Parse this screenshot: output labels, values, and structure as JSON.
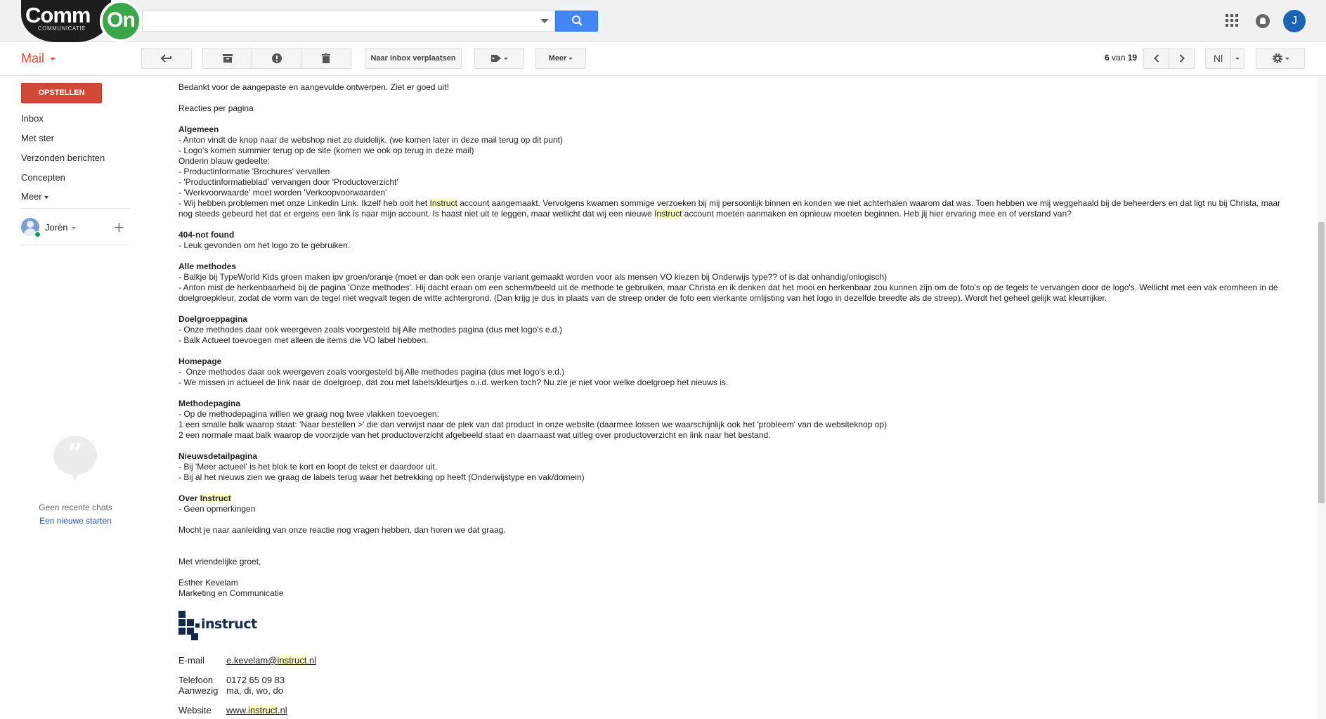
{
  "brand": {
    "logo_text": "Comm",
    "logo_on": "On",
    "logo_sub": "COMMUNICATIE"
  },
  "search": {
    "value": "",
    "placeholder": ""
  },
  "top_right": {
    "avatar_letter": "J"
  },
  "toolbar": {
    "mail_label": "Mail",
    "back_icon": "reply-back-icon",
    "archive_icon": "archive-icon",
    "spam_icon": "report-spam-icon",
    "delete_icon": "trash-icon",
    "move_inbox_label": "Naar inbox verplaatsen",
    "labels_icon": "label-tag-icon",
    "more_label": "Meer",
    "pager_current": "6",
    "pager_sep": " van ",
    "pager_total": "19",
    "language_label": "Nl",
    "settings_icon": "gear-icon"
  },
  "sidebar": {
    "compose_label": "OPSTELLEN",
    "items": [
      {
        "label": "Inbox"
      },
      {
        "label": "Met ster"
      },
      {
        "label": "Verzonden berichten"
      },
      {
        "label": "Concepten"
      },
      {
        "label": "Meer"
      }
    ],
    "user_name": "Jorèn",
    "no_chats": "Geen recente chats",
    "new_chat": "Een nieuwe starten"
  },
  "message": {
    "intro": "Bedankt voor de aangepaste en aangevulde ontwerpen. Ziet er goed uit!",
    "reactions_title": "Reacties per pagina",
    "algemeen_title": "Algemeen",
    "algemeen_lines": [
      "- Anton vindt de knop naar de webshop niet zo duidelijk. (we komen later in deze mail terug op dit punt)",
      "- Logo's komen summier terug op de site (komen we ook op terug in deze mail)",
      "Onderin blauw gedeelte:",
      "- Productinformatie 'Brochures' vervallen",
      "- 'Productinformatieblad' vervangen door 'Productoverzicht'",
      "- 'Werkvoorwaarde' moet worden 'Verkoopvoorwaarden'"
    ],
    "linkedin_a": "- Wij hebben problemen met onze Linkedin Link. Ikzelf heb ooit het ",
    "linkedin_hl1": "Instruct",
    "linkedin_b": " account aangemaakt. Vervolgens kwamen sommige verzoeken bij mij persoonlijk binnen en konden we niet achterhalen waarom dat was. Toen hebben we mij weggehaald bij de beheerders en dat ligt nu bij Christa, maar nog steeds gebeurd het dat er ergens een link is naar mijn account. Is haast niet uit te leggen, maar wellicht dat wij een nieuwe ",
    "linkedin_hl2": "Instruct",
    "linkedin_c": " account moeten aanmaken en opnieuw moeten beginnen. Heb jij hier ervaring mee en of verstand van?",
    "notfound_title": "404-not found",
    "notfound_lines": [
      "- Leuk gevonden om het logo zo te gebruiken."
    ],
    "methodes_title": "Alle methodes",
    "methodes_lines": [
      "- Balkje bij TypeWorld Kids groen maken ipv groen/oranje (moet er dan ook een oranje variant gemaakt worden voor als mensen VO kiezen bij Onderwijs type?? of is dat onhandig/onlogisch)",
      "- Anton mist de herkenbaarheid bij de pagina 'Onze methodes'. Hij dacht eraan om een scherm/beeld uit de methode te gebruiken, maar Christa en ik denken dat het mooi en herkenbaar zou kunnen zijn om de foto's op de tegels te vervangen door de logo's. Wellicht met een vak eromheen in de doelgroepkleur, zodat de vorm van de tegel niet wegvalt tegen de witte achtergrond. (Dan krijg je dus in plaats van de streep onder de foto een vierkante omlijsting van het logo in dezelfde breedte als de streep). Wordt het geheel gelijk wat kleurrijker."
    ],
    "doelgroep_title": "Doelgroeppagina",
    "doelgroep_lines": [
      "- Onze methodes daar ook weergeven zoals voorgesteld bij Alle methodes pagina (dus met logo's e.d.)",
      "- Balk Actueel toevoegen met alleen de items die VO label hebben."
    ],
    "homepage_title": "Homepage",
    "homepage_lines": [
      "-  Onze methodes daar ook weergeven zoals voorgesteld bij Alle methodes pagina (dus met logo's e.d.)",
      "- We missen in actueel de link naar de doelgroep, dat zou met labels/kleurtjes o.i.d. werken toch? Nu zie je niet voor welke doelgroep het nieuws is."
    ],
    "methodepagina_title": "Methodepagina",
    "methodepagina_lines": [
      "- Op de methodepagina willen we graag nog twee vlakken toevoegen:",
      "1 een smalle balk waarop staat: 'Naar bestellen >' die dan verwijst naar de plek van dat product in onze website (daarmee lossen we waarschijnlijk ook het 'probleem' van de websiteknop op)",
      "2 een normale maat balk waarop de voorzijde van het productoverzicht afgebeeld staat en daarnaast wat uitleg over productoverzicht en link naar het bestand."
    ],
    "nieuws_title": "Nieuwsdetailpagina",
    "nieuws_lines": [
      "- Bij 'Meer actueel' is het blok te kort en loopt de tekst er daardoor uit.",
      "- Bij al het nieuws zien we graag de labels terug waar het betrekking op heeft (Onderwijstype en vak/domein)"
    ],
    "over_title_a": "Over ",
    "over_title_hl": "Instruct",
    "over_lines": [
      "- Geen opmerkingen"
    ],
    "closing": "Mocht je naar aanleiding van onze reactie nog vragen hebben, dan horen we dat graag.",
    "greeting": "Met vriendelijke groet,",
    "sender_name": "Esther Kevelam",
    "sender_role": "Marketing en Communicatie",
    "logo_word": "instruct",
    "email_label": "E-mail",
    "email_a": "e.kevelam@",
    "email_hl": "instruct",
    "email_b": ".nl",
    "phone_label": "Telefoon",
    "phone_value": "0172 65 09 83",
    "present_label": "Aanwezig",
    "present_value": "ma, di, wo, do",
    "website_label": "Website",
    "website_a": "www.",
    "website_hl": "instruct",
    "website_b": ".nl"
  }
}
